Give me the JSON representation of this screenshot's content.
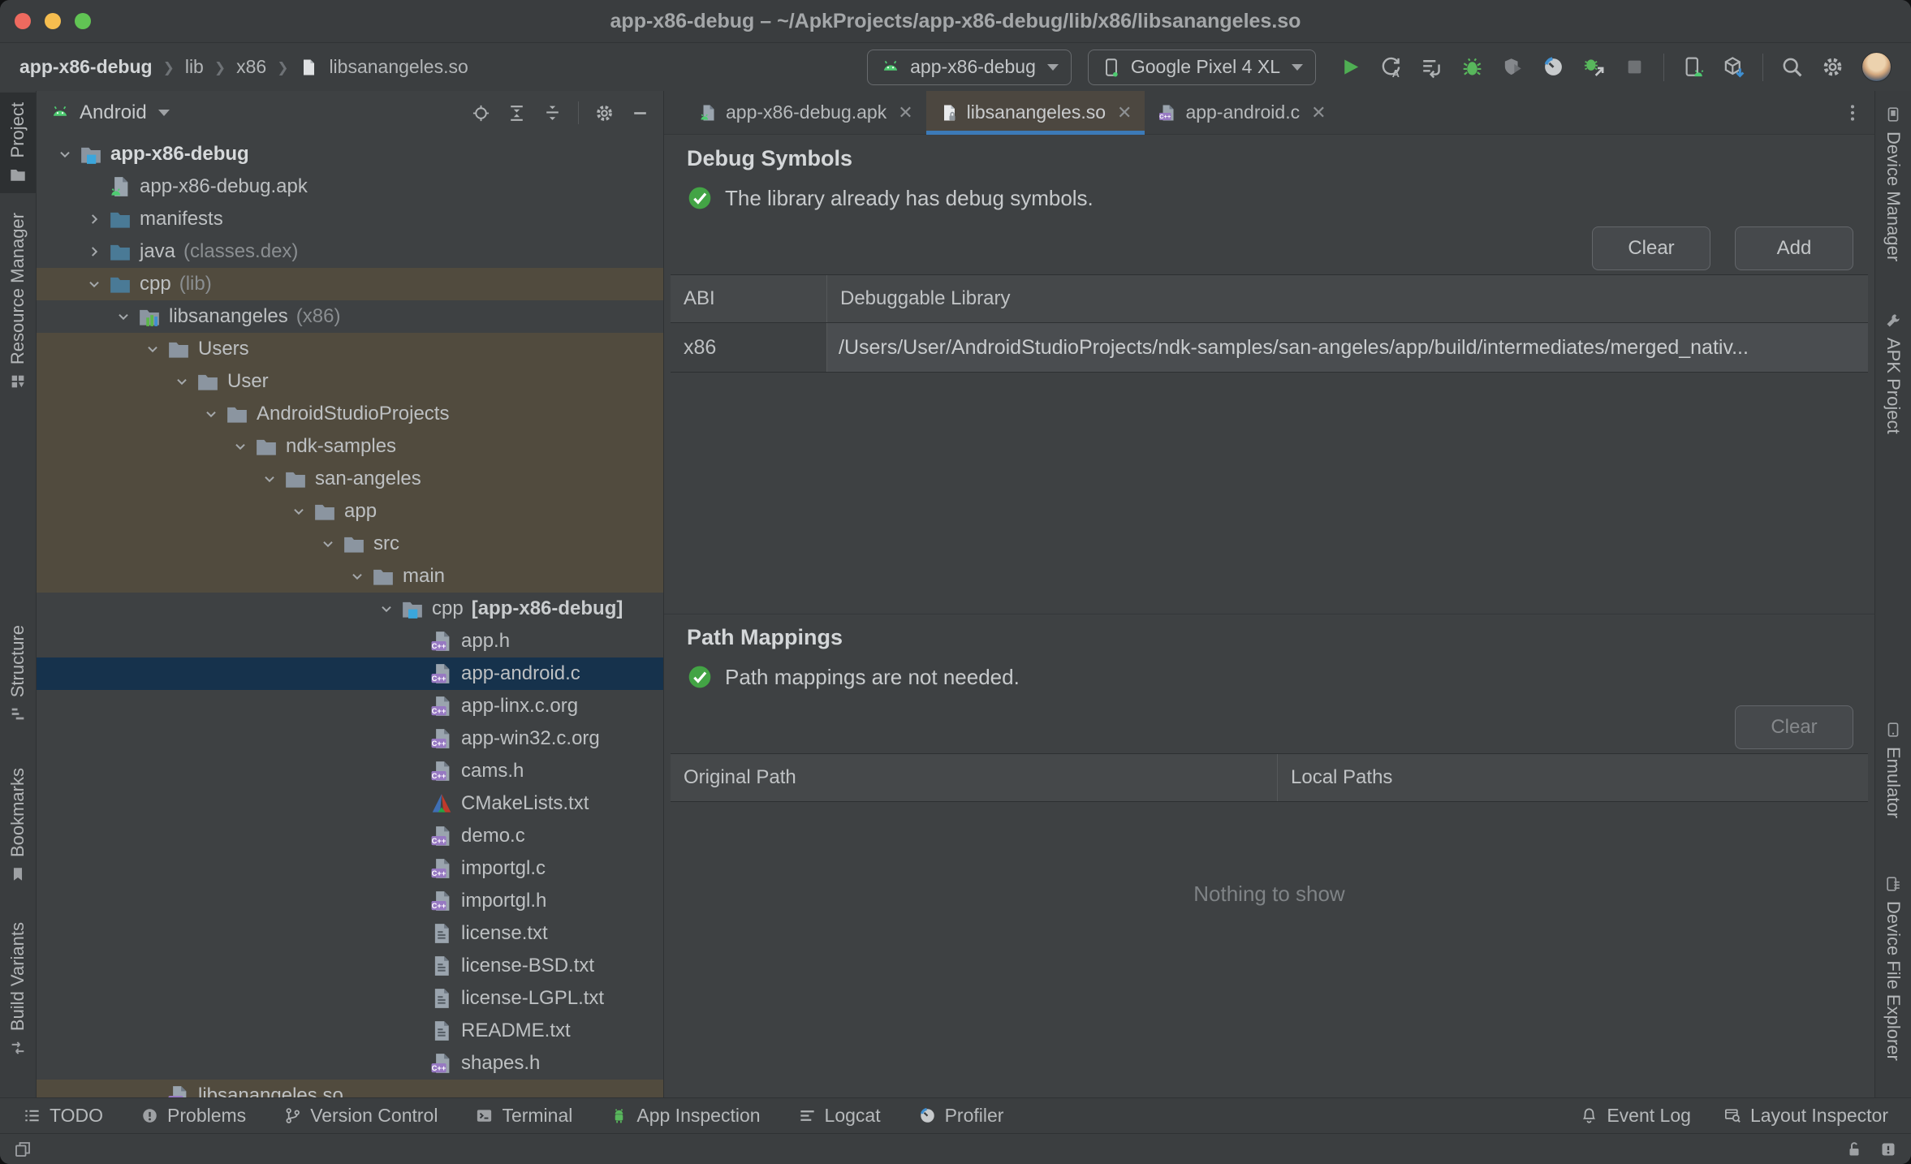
{
  "window": {
    "title": "app-x86-debug – ~/ApkProjects/app-x86-debug/lib/x86/libsanangeles.so"
  },
  "breadcrumbs": {
    "items": [
      "app-x86-debug",
      "lib",
      "x86",
      "libsanangeles.so"
    ],
    "separator": "❯",
    "file_icon": "file"
  },
  "toolbar": {
    "run_config": "app-x86-debug",
    "device": "Google Pixel 4 XL",
    "actions": [
      "run",
      "apply-changes",
      "sync",
      "debug",
      "shield-run",
      "profile",
      "attach-debugger",
      "stop",
      "separator",
      "device-manager",
      "avd-manager",
      "separator",
      "search-everywhere",
      "settings",
      "avatar"
    ]
  },
  "left_sidebar": {
    "items": [
      {
        "label": "Project",
        "icon": "project",
        "active": true
      },
      {
        "label": "Resource Manager",
        "icon": "resource-manager",
        "active": false
      },
      {
        "label": "Structure",
        "icon": "structure",
        "active": false
      },
      {
        "label": "Bookmarks",
        "icon": "bookmarks",
        "active": false
      },
      {
        "label": "Build Variants",
        "icon": "build-variants",
        "active": false
      }
    ]
  },
  "right_sidebar": {
    "items": [
      {
        "label": "Device Manager",
        "icon": "device-manager-side"
      },
      {
        "label": "APK Project",
        "icon": "apk-project"
      },
      {
        "label": "Emulator",
        "icon": "emulator-side"
      },
      {
        "label": "Device File Explorer",
        "icon": "device-file-explorer"
      }
    ]
  },
  "project_panel": {
    "view_selector": "Android",
    "header_actions": [
      "locate",
      "expand-all",
      "collapse-all",
      "separator",
      "settings",
      "hide"
    ],
    "tree": [
      {
        "label": "app-x86-debug",
        "icon": "folder-project",
        "level": 0,
        "arrow": "down",
        "highlight": "",
        "bold": true
      },
      {
        "label": "app-x86-debug.apk",
        "icon": "apk-file",
        "level": 1,
        "arrow": "",
        "highlight": ""
      },
      {
        "label": "manifests",
        "icon": "folder-blue",
        "level": 1,
        "arrow": "right",
        "highlight": ""
      },
      {
        "label": "java",
        "suffix": "(classes.dex)",
        "icon": "folder-blue",
        "level": 1,
        "arrow": "right",
        "highlight": ""
      },
      {
        "label": "cpp",
        "suffix": "(lib)",
        "icon": "folder-blue",
        "level": 1,
        "arrow": "down",
        "highlight": "brown"
      },
      {
        "label": "libsanangeles",
        "suffix": "(x86)",
        "icon": "lib-folder",
        "level": 2,
        "arrow": "down",
        "highlight": ""
      },
      {
        "label": "Users",
        "icon": "folder-gray",
        "level": 3,
        "arrow": "down",
        "highlight": "brown"
      },
      {
        "label": "User",
        "icon": "folder-gray",
        "level": 4,
        "arrow": "down",
        "highlight": "brown"
      },
      {
        "label": "AndroidStudioProjects",
        "icon": "folder-gray",
        "level": 5,
        "arrow": "down",
        "highlight": "brown"
      },
      {
        "label": "ndk-samples",
        "icon": "folder-gray",
        "level": 6,
        "arrow": "down",
        "highlight": "brown"
      },
      {
        "label": "san-angeles",
        "icon": "folder-gray",
        "level": 7,
        "arrow": "down",
        "highlight": "brown"
      },
      {
        "label": "app",
        "icon": "folder-gray",
        "level": 8,
        "arrow": "down",
        "highlight": "brown"
      },
      {
        "label": "src",
        "icon": "folder-gray",
        "level": 9,
        "arrow": "down",
        "highlight": "brown"
      },
      {
        "label": "main",
        "icon": "folder-gray",
        "level": 10,
        "arrow": "down",
        "highlight": "brown"
      },
      {
        "label": "cpp",
        "suffix_bold": "[app-x86-debug]",
        "icon": "folder-project",
        "level": 11,
        "arrow": "down",
        "highlight": ""
      },
      {
        "label": "app.h",
        "icon": "c-file",
        "level": 12,
        "arrow": "",
        "highlight": ""
      },
      {
        "label": "app-android.c",
        "icon": "c-file",
        "level": 12,
        "arrow": "",
        "highlight": "navy"
      },
      {
        "label": "app-linx.c.org",
        "icon": "c-file",
        "level": 12,
        "arrow": "",
        "highlight": ""
      },
      {
        "label": "app-win32.c.org",
        "icon": "c-file",
        "level": 12,
        "arrow": "",
        "highlight": ""
      },
      {
        "label": "cams.h",
        "icon": "c-file",
        "level": 12,
        "arrow": "",
        "highlight": ""
      },
      {
        "label": "CMakeLists.txt",
        "icon": "cmake-file",
        "level": 12,
        "arrow": "",
        "highlight": ""
      },
      {
        "label": "demo.c",
        "icon": "c-file",
        "level": 12,
        "arrow": "",
        "highlight": ""
      },
      {
        "label": "importgl.c",
        "icon": "c-file",
        "level": 12,
        "arrow": "",
        "highlight": ""
      },
      {
        "label": "importgl.h",
        "icon": "c-file",
        "level": 12,
        "arrow": "",
        "highlight": ""
      },
      {
        "label": "license.txt",
        "icon": "text-file",
        "level": 12,
        "arrow": "",
        "highlight": ""
      },
      {
        "label": "license-BSD.txt",
        "icon": "text-file",
        "level": 12,
        "arrow": "",
        "highlight": ""
      },
      {
        "label": "license-LGPL.txt",
        "icon": "text-file",
        "level": 12,
        "arrow": "",
        "highlight": ""
      },
      {
        "label": "README.txt",
        "icon": "text-file",
        "level": 12,
        "arrow": "",
        "highlight": ""
      },
      {
        "label": "shapes.h",
        "icon": "c-file",
        "level": 12,
        "arrow": "",
        "highlight": ""
      },
      {
        "label": "libsanangeles.so",
        "icon": "c-file",
        "level": 3,
        "arrow": "",
        "highlight": "brown"
      }
    ]
  },
  "editor": {
    "close_glyph": "✕",
    "tabs": [
      {
        "label": "app-x86-debug.apk",
        "icon": "apk-file",
        "active": false
      },
      {
        "label": "libsanangeles.so",
        "icon": "so-file",
        "active": true
      },
      {
        "label": "app-android.c",
        "icon": "c-file",
        "active": false
      }
    ],
    "debug_symbols": {
      "title": "Debug Symbols",
      "message": "The library already has debug symbols.",
      "clear_label": "Clear",
      "add_label": "Add",
      "table_headers": [
        "ABI",
        "Debuggable Library"
      ],
      "row": {
        "abi": "x86",
        "path": "/Users/User/AndroidStudioProjects/ndk-samples/san-angeles/app/build/intermediates/merged_nativ..."
      }
    },
    "path_mappings": {
      "title": "Path Mappings",
      "message": "Path mappings are not needed.",
      "clear_label": "Clear",
      "table_headers": [
        "Original Path",
        "Local Paths"
      ],
      "empty_text": "Nothing to show"
    }
  },
  "bottom_bar": {
    "left": [
      {
        "label": "TODO",
        "icon": "todo"
      },
      {
        "label": "Problems",
        "icon": "problems"
      },
      {
        "label": "Version Control",
        "icon": "version-control"
      },
      {
        "label": "Terminal",
        "icon": "terminal"
      },
      {
        "label": "App Inspection",
        "icon": "app-inspection"
      },
      {
        "label": "Logcat",
        "icon": "logcat"
      },
      {
        "label": "Profiler",
        "icon": "profiler"
      }
    ],
    "right": [
      {
        "label": "Event Log",
        "icon": "event-log"
      },
      {
        "label": "Layout Inspector",
        "icon": "layout-inspector"
      }
    ]
  },
  "status_bar": {
    "icons_left": [
      "window-stack"
    ],
    "icons_right": [
      "unlock",
      "notifications"
    ]
  },
  "colors": {
    "selection_navy": "#16324C",
    "highlight_brown": "#514B3E",
    "tab_underline": "#3C7AB8",
    "success_green": "#43A445",
    "android_green": "#4ECB71",
    "folder_blue": "#4A7A96",
    "cpp_purple": "#9779C2"
  }
}
